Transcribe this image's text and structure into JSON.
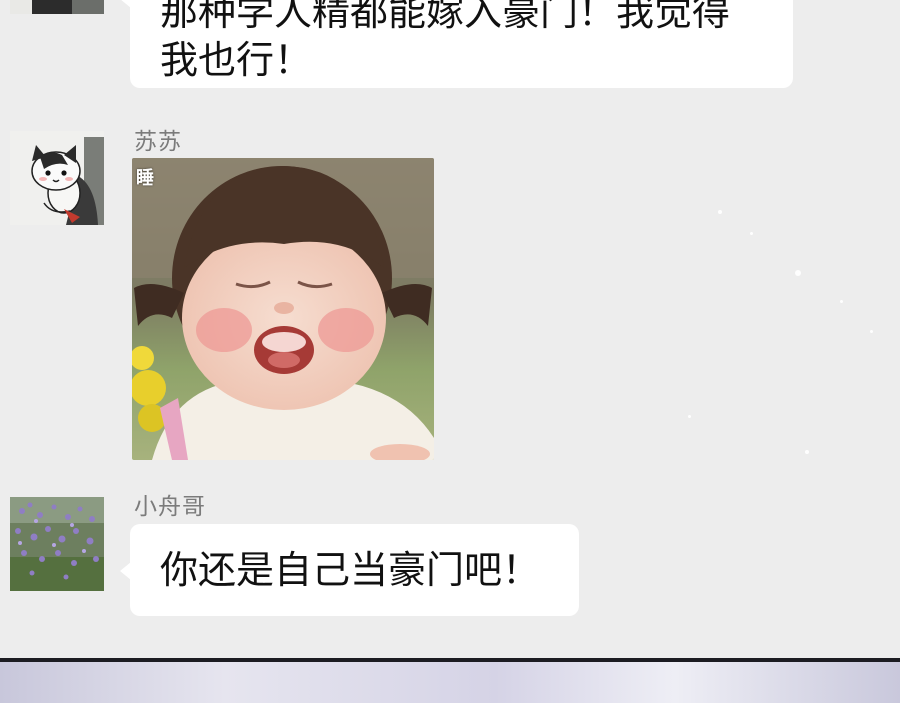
{
  "messages": [
    {
      "sender": "",
      "type": "text",
      "lines": [
        "那种学人精都能嫁入豪门！我觉得",
        "我也行！"
      ]
    },
    {
      "sender": "苏苏",
      "type": "sticker",
      "avatar_icon": "cat-avatar-icon",
      "sticker_caption": "睡"
    },
    {
      "sender": "小舟哥",
      "type": "text",
      "avatar_icon": "lavender-field-avatar-icon",
      "lines": [
        "你还是自己当豪门吧！"
      ]
    }
  ],
  "colors": {
    "chat_background": "#ededed",
    "bubble": "#ffffff",
    "sender_name": "#7b7b7b",
    "message_text": "#111111"
  }
}
